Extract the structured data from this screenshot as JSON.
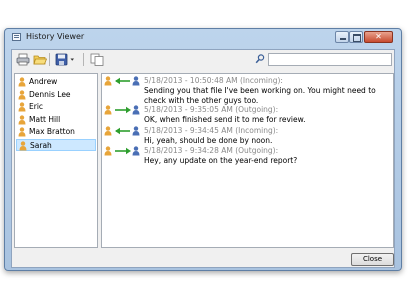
{
  "window": {
    "title": "History Viewer"
  },
  "toolbar": {
    "icons": [
      "printer-icon",
      "folder-open-icon",
      "save-icon",
      "copy-icon",
      "search-icon"
    ],
    "search_value": ""
  },
  "contacts": [
    {
      "name": "Andrew",
      "selected": false
    },
    {
      "name": "Dennis Lee",
      "selected": false
    },
    {
      "name": "Eric",
      "selected": false
    },
    {
      "name": "Matt Hill",
      "selected": false
    },
    {
      "name": "Max Bratton",
      "selected": false
    },
    {
      "name": "Sarah",
      "selected": true
    }
  ],
  "messages": [
    {
      "direction": "Incoming",
      "meta": "5/18/2013 - 10:50:48 AM (Incoming):",
      "text": "Sending you that file I've been working on. You might need to check with the other guys too."
    },
    {
      "direction": "Outgoing",
      "meta": "5/18/2013 - 9:35:05 AM (Outgoing):",
      "text": "OK, when finished send it to me for review."
    },
    {
      "direction": "Incoming",
      "meta": "5/18/2013 - 9:34:45 AM (Incoming):",
      "text": "Hi, yeah, should be done by noon."
    },
    {
      "direction": "Outgoing",
      "meta": "5/18/2013 - 9:34:28 AM (Outgoing):",
      "text": "Hey, any update on the year-end report?"
    }
  ],
  "footer": {
    "close_label": "Close"
  },
  "colors": {
    "arrow": "#2e9e2e",
    "user_orange": "#e8a53a",
    "user_blue": "#4a6fb5",
    "selection": "#cde8ff"
  }
}
